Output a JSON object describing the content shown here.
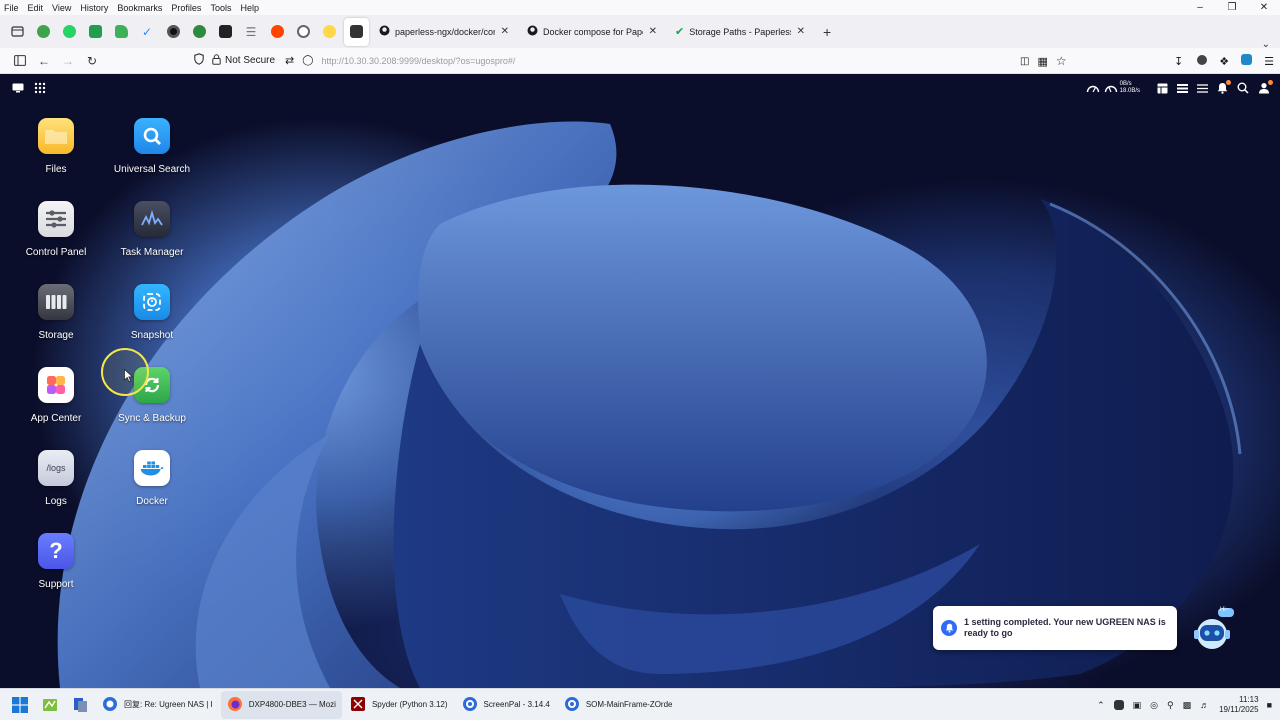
{
  "browser": {
    "menu": [
      "File",
      "Edit",
      "View",
      "History",
      "Bookmarks",
      "Profiles",
      "Tools",
      "Help"
    ],
    "tabs": [
      {
        "label": "paperless-ngx/docker/compose",
        "icon": "github-icon"
      },
      {
        "label": "Docker compose for Paperless-",
        "icon": "github-icon"
      },
      {
        "label": "Storage Paths - Paperless-ngx",
        "icon": "paperless-leaf-icon"
      }
    ],
    "security_label": "Not Secure",
    "url": "http://10.30.30.208:9999/desktop/?os=ugospro#/"
  },
  "nas": {
    "netspeed_up": "0B/s",
    "netspeed_down": "18.0B/s",
    "apps": [
      {
        "label": "Files",
        "icon": "folder-icon"
      },
      {
        "label": "Universal Search",
        "icon": "search-icon"
      },
      {
        "label": "Control Panel",
        "icon": "control-panel-icon"
      },
      {
        "label": "Task Manager",
        "icon": "task-manager-icon"
      },
      {
        "label": "Storage",
        "icon": "storage-icon"
      },
      {
        "label": "Snapshot",
        "icon": "snapshot-icon"
      },
      {
        "label": "App Center",
        "icon": "app-center-icon"
      },
      {
        "label": "Sync & Backup",
        "icon": "sync-icon"
      },
      {
        "label": "Logs",
        "icon": "logs-icon",
        "icon_text": "/logs"
      },
      {
        "label": "Docker",
        "icon": "docker-icon"
      },
      {
        "label": "Support",
        "icon": "help-icon",
        "icon_text": "?"
      }
    ],
    "notification": "1 setting completed. Your new UGREEN NAS is ready to go",
    "robot_badge": "Hi~"
  },
  "taskbar": {
    "apps": [
      {
        "label": "回复: Re: Ugreen NAS | I",
        "icon": "browser-icon"
      },
      {
        "label": "DXP4800-DBE3 — Mozi",
        "icon": "firefox-icon"
      },
      {
        "label": "Spyder (Python 3.12)",
        "icon": "spyder-icon"
      },
      {
        "label": "ScreenPal - 3.14.4",
        "icon": "screenpal-icon"
      },
      {
        "label": "SOM-MainFrame-ZOrde",
        "icon": "screenpal-icon"
      }
    ],
    "time": "11:13",
    "date": "19/11/2025"
  },
  "colors": {
    "accent": "#2f6bf6",
    "wallpaper": "#0b0e2a"
  }
}
